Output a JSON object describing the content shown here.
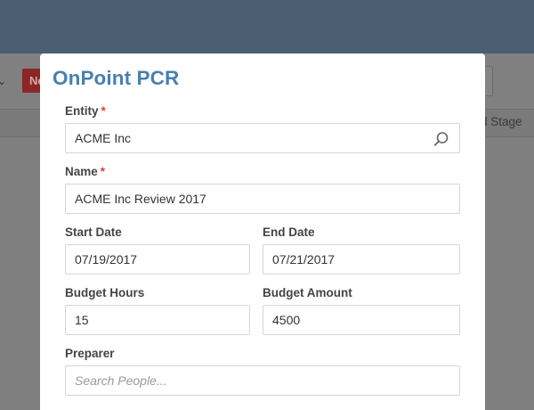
{
  "background": {
    "new_button_label": "Ne",
    "column_header_partial": "d Stage"
  },
  "modal": {
    "title": "OnPoint PCR",
    "fields": {
      "entity": {
        "label": "Entity",
        "required_mark": "*",
        "value": "ACME Inc"
      },
      "name": {
        "label": "Name",
        "required_mark": "*",
        "value": "ACME Inc Review 2017"
      },
      "start_date": {
        "label": "Start Date",
        "value": "07/19/2017"
      },
      "end_date": {
        "label": "End Date",
        "value": "07/21/2017"
      },
      "budget_hours": {
        "label": "Budget Hours",
        "value": "15"
      },
      "budget_amount": {
        "label": "Budget Amount",
        "value": "4500"
      },
      "preparer": {
        "label": "Preparer",
        "value": "",
        "placeholder": "Search People..."
      }
    }
  },
  "colors": {
    "header": "#4b5d70",
    "title": "#4a7fad",
    "required": "#d04444"
  }
}
